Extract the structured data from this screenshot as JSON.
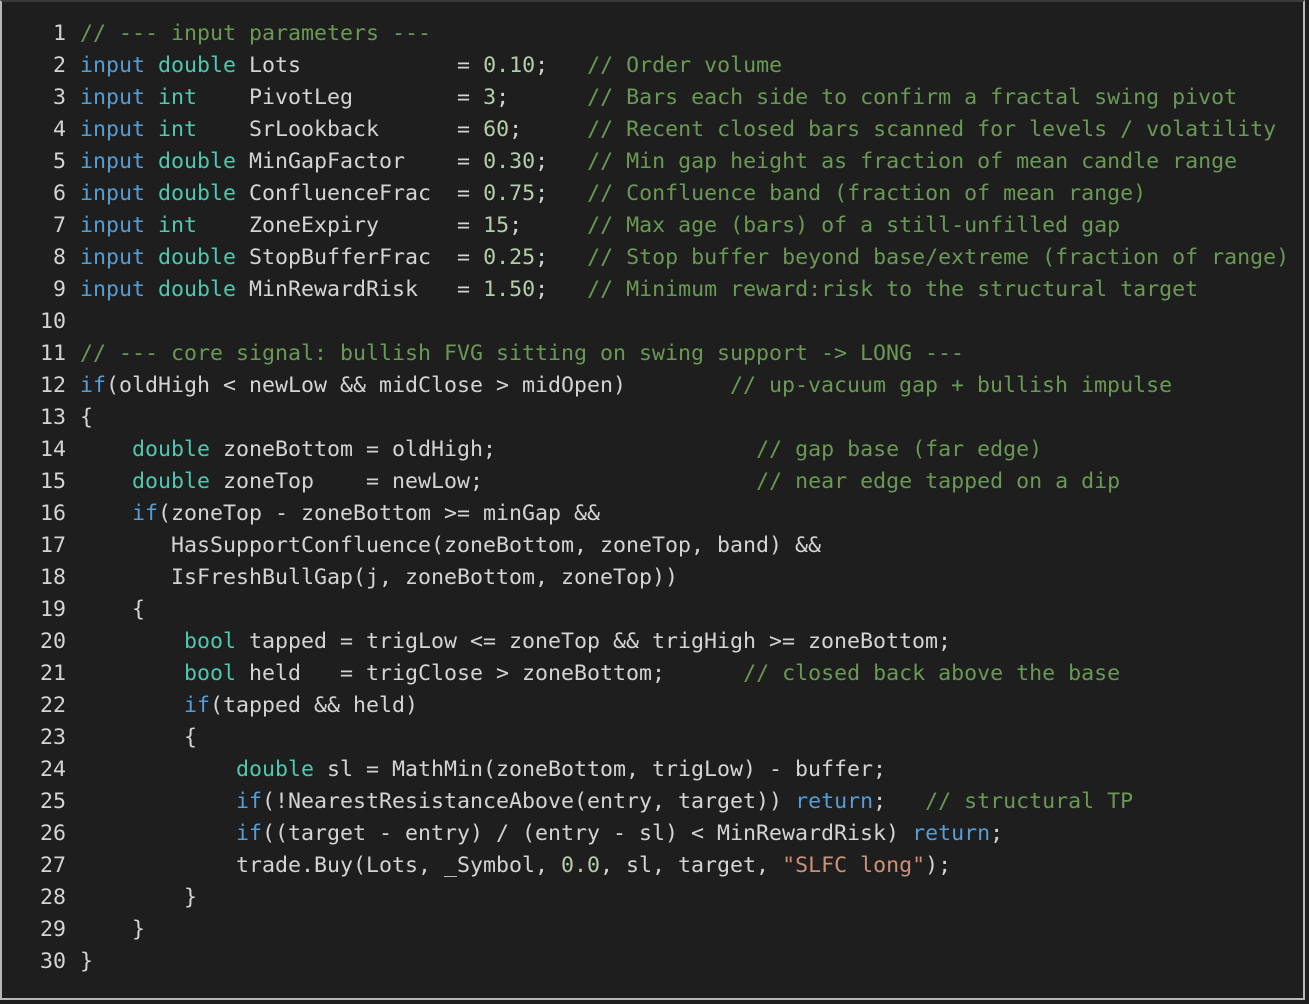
{
  "colors": {
    "background": "#1e1e1e",
    "keyword": "#569cd6",
    "type": "#4ec9b0",
    "comment": "#6a9955",
    "number": "#b5cea8",
    "string": "#ce9178",
    "text": "#d4d4d4"
  },
  "lines": [
    {
      "n": "1",
      "tokens": [
        {
          "t": "cm",
          "v": "// --- input parameters ---"
        }
      ]
    },
    {
      "n": "2",
      "tokens": [
        {
          "t": "kw",
          "v": "input"
        },
        {
          "t": "tx",
          "v": " "
        },
        {
          "t": "ty",
          "v": "double"
        },
        {
          "t": "tx",
          "v": " Lots            = "
        },
        {
          "t": "num",
          "v": "0.10"
        },
        {
          "t": "tx",
          "v": ";   "
        },
        {
          "t": "cm",
          "v": "// Order volume"
        }
      ]
    },
    {
      "n": "3",
      "tokens": [
        {
          "t": "kw",
          "v": "input"
        },
        {
          "t": "tx",
          "v": " "
        },
        {
          "t": "ty",
          "v": "int"
        },
        {
          "t": "tx",
          "v": "    PivotLeg        = "
        },
        {
          "t": "num",
          "v": "3"
        },
        {
          "t": "tx",
          "v": ";      "
        },
        {
          "t": "cm",
          "v": "// Bars each side to confirm a fractal swing pivot"
        }
      ]
    },
    {
      "n": "4",
      "tokens": [
        {
          "t": "kw",
          "v": "input"
        },
        {
          "t": "tx",
          "v": " "
        },
        {
          "t": "ty",
          "v": "int"
        },
        {
          "t": "tx",
          "v": "    SrLookback      = "
        },
        {
          "t": "num",
          "v": "60"
        },
        {
          "t": "tx",
          "v": ";     "
        },
        {
          "t": "cm",
          "v": "// Recent closed bars scanned for levels / volatility"
        }
      ]
    },
    {
      "n": "5",
      "tokens": [
        {
          "t": "kw",
          "v": "input"
        },
        {
          "t": "tx",
          "v": " "
        },
        {
          "t": "ty",
          "v": "double"
        },
        {
          "t": "tx",
          "v": " MinGapFactor    = "
        },
        {
          "t": "num",
          "v": "0.30"
        },
        {
          "t": "tx",
          "v": ";   "
        },
        {
          "t": "cm",
          "v": "// Min gap height as fraction of mean candle range"
        }
      ]
    },
    {
      "n": "6",
      "tokens": [
        {
          "t": "kw",
          "v": "input"
        },
        {
          "t": "tx",
          "v": " "
        },
        {
          "t": "ty",
          "v": "double"
        },
        {
          "t": "tx",
          "v": " ConfluenceFrac  = "
        },
        {
          "t": "num",
          "v": "0.75"
        },
        {
          "t": "tx",
          "v": ";   "
        },
        {
          "t": "cm",
          "v": "// Confluence band (fraction of mean range)"
        }
      ]
    },
    {
      "n": "7",
      "tokens": [
        {
          "t": "kw",
          "v": "input"
        },
        {
          "t": "tx",
          "v": " "
        },
        {
          "t": "ty",
          "v": "int"
        },
        {
          "t": "tx",
          "v": "    ZoneExpiry      = "
        },
        {
          "t": "num",
          "v": "15"
        },
        {
          "t": "tx",
          "v": ";     "
        },
        {
          "t": "cm",
          "v": "// Max age (bars) of a still-unfilled gap"
        }
      ]
    },
    {
      "n": "8",
      "tokens": [
        {
          "t": "kw",
          "v": "input"
        },
        {
          "t": "tx",
          "v": " "
        },
        {
          "t": "ty",
          "v": "double"
        },
        {
          "t": "tx",
          "v": " StopBufferFrac  = "
        },
        {
          "t": "num",
          "v": "0.25"
        },
        {
          "t": "tx",
          "v": ";   "
        },
        {
          "t": "cm",
          "v": "// Stop buffer beyond base/extreme (fraction of range)"
        }
      ]
    },
    {
      "n": "9",
      "tokens": [
        {
          "t": "kw",
          "v": "input"
        },
        {
          "t": "tx",
          "v": " "
        },
        {
          "t": "ty",
          "v": "double"
        },
        {
          "t": "tx",
          "v": " MinRewardRisk   = "
        },
        {
          "t": "num",
          "v": "1.50"
        },
        {
          "t": "tx",
          "v": ";   "
        },
        {
          "t": "cm",
          "v": "// Minimum reward:risk to the structural target"
        }
      ]
    },
    {
      "n": "10",
      "tokens": []
    },
    {
      "n": "11",
      "tokens": [
        {
          "t": "cm",
          "v": "// --- core signal: bullish FVG sitting on swing support -> LONG ---"
        }
      ]
    },
    {
      "n": "12",
      "tokens": [
        {
          "t": "kw",
          "v": "if"
        },
        {
          "t": "tx",
          "v": "(oldHigh < newLow && midClose > midOpen)        "
        },
        {
          "t": "cm",
          "v": "// up-vacuum gap + bullish impulse"
        }
      ]
    },
    {
      "n": "13",
      "tokens": [
        {
          "t": "tx",
          "v": "{"
        }
      ]
    },
    {
      "n": "14",
      "tokens": [
        {
          "t": "tx",
          "v": "    "
        },
        {
          "t": "ty",
          "v": "double"
        },
        {
          "t": "tx",
          "v": " zoneBottom = oldHigh;                    "
        },
        {
          "t": "cm",
          "v": "// gap base (far edge)"
        }
      ]
    },
    {
      "n": "15",
      "tokens": [
        {
          "t": "tx",
          "v": "    "
        },
        {
          "t": "ty",
          "v": "double"
        },
        {
          "t": "tx",
          "v": " zoneTop    = newLow;                     "
        },
        {
          "t": "cm",
          "v": "// near edge tapped on a dip"
        }
      ]
    },
    {
      "n": "16",
      "tokens": [
        {
          "t": "tx",
          "v": "    "
        },
        {
          "t": "kw",
          "v": "if"
        },
        {
          "t": "tx",
          "v": "(zoneTop - zoneBottom >= minGap &&"
        }
      ]
    },
    {
      "n": "17",
      "tokens": [
        {
          "t": "tx",
          "v": "       HasSupportConfluence(zoneBottom, zoneTop, band) &&"
        }
      ]
    },
    {
      "n": "18",
      "tokens": [
        {
          "t": "tx",
          "v": "       IsFreshBullGap(j, zoneBottom, zoneTop))"
        }
      ]
    },
    {
      "n": "19",
      "tokens": [
        {
          "t": "tx",
          "v": "    {"
        }
      ]
    },
    {
      "n": "20",
      "tokens": [
        {
          "t": "tx",
          "v": "        "
        },
        {
          "t": "ty",
          "v": "bool"
        },
        {
          "t": "tx",
          "v": " tapped = trigLow <= zoneTop && trigHigh >= zoneBottom;"
        }
      ]
    },
    {
      "n": "21",
      "tokens": [
        {
          "t": "tx",
          "v": "        "
        },
        {
          "t": "ty",
          "v": "bool"
        },
        {
          "t": "tx",
          "v": " held   = trigClose > zoneBottom;      "
        },
        {
          "t": "cm",
          "v": "// closed back above the base"
        }
      ]
    },
    {
      "n": "22",
      "tokens": [
        {
          "t": "tx",
          "v": "        "
        },
        {
          "t": "kw",
          "v": "if"
        },
        {
          "t": "tx",
          "v": "(tapped && held)"
        }
      ]
    },
    {
      "n": "23",
      "tokens": [
        {
          "t": "tx",
          "v": "        {"
        }
      ]
    },
    {
      "n": "24",
      "tokens": [
        {
          "t": "tx",
          "v": "            "
        },
        {
          "t": "ty",
          "v": "double"
        },
        {
          "t": "tx",
          "v": " sl = MathMin(zoneBottom, trigLow) - buffer;"
        }
      ]
    },
    {
      "n": "25",
      "tokens": [
        {
          "t": "tx",
          "v": "            "
        },
        {
          "t": "kw",
          "v": "if"
        },
        {
          "t": "tx",
          "v": "(!NearestResistanceAbove(entry, target)) "
        },
        {
          "t": "kw",
          "v": "return"
        },
        {
          "t": "tx",
          "v": ";   "
        },
        {
          "t": "cm",
          "v": "// structural TP"
        }
      ]
    },
    {
      "n": "26",
      "tokens": [
        {
          "t": "tx",
          "v": "            "
        },
        {
          "t": "kw",
          "v": "if"
        },
        {
          "t": "tx",
          "v": "((target - entry) / (entry - sl) < MinRewardRisk) "
        },
        {
          "t": "kw",
          "v": "return"
        },
        {
          "t": "tx",
          "v": ";"
        }
      ]
    },
    {
      "n": "27",
      "tokens": [
        {
          "t": "tx",
          "v": "            trade.Buy(Lots, _Symbol, "
        },
        {
          "t": "num",
          "v": "0.0"
        },
        {
          "t": "tx",
          "v": ", sl, target, "
        },
        {
          "t": "str",
          "v": "\"SLFC long\""
        },
        {
          "t": "tx",
          "v": ");"
        }
      ]
    },
    {
      "n": "28",
      "tokens": [
        {
          "t": "tx",
          "v": "        }"
        }
      ]
    },
    {
      "n": "29",
      "tokens": [
        {
          "t": "tx",
          "v": "    }"
        }
      ]
    },
    {
      "n": "30",
      "tokens": [
        {
          "t": "tx",
          "v": "}"
        }
      ]
    }
  ]
}
